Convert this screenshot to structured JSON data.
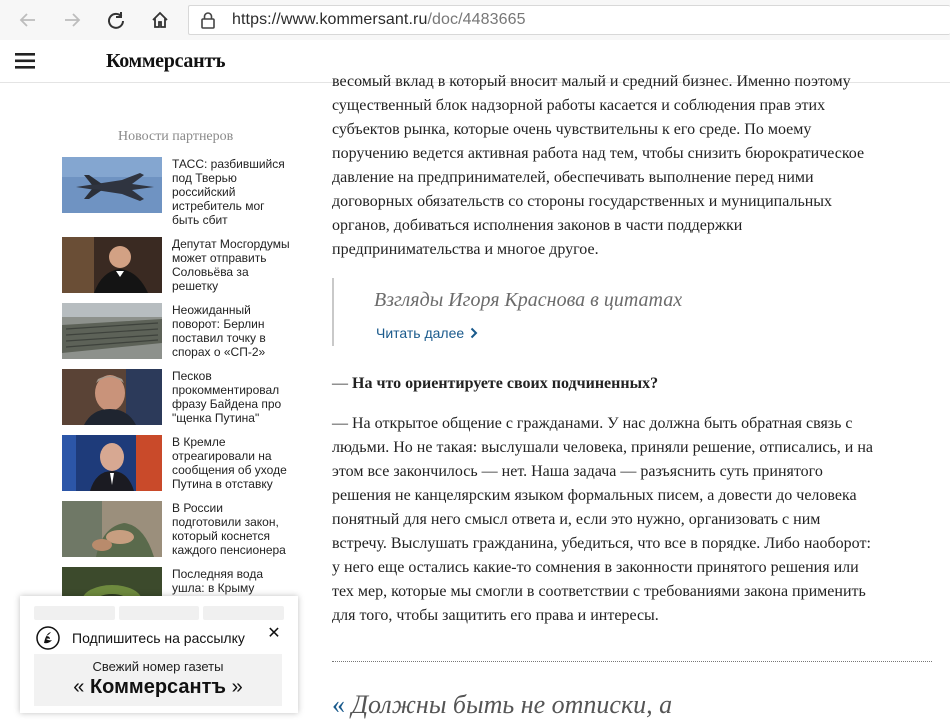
{
  "browser": {
    "url_host": "https://www.kommersant.ru",
    "url_path": "/doc/4483665",
    "icons": [
      "back-arrow-icon",
      "forward-arrow-icon",
      "reload-icon",
      "home-icon",
      "lock-icon"
    ]
  },
  "site": {
    "logo": "Коммерсантъ",
    "menu_icon": "hamburger-icon"
  },
  "sidebar": {
    "title": "Новости партнеров",
    "news": [
      {
        "lines": [
          "ТАСС: разбившийся",
          "под Тверью",
          "российский",
          "истребитель мог",
          "быть сбит"
        ],
        "thumb": "fighter-jet-image"
      },
      {
        "lines": [
          "Депутат Мосгордумы",
          "может отправить",
          "Соловьёва за",
          "решетку"
        ],
        "thumb": "man-in-tuxedo-image"
      },
      {
        "lines": [
          "Неожиданный",
          "поворот: Берлин",
          "поставил точку в",
          "спорах о «СП-2»"
        ],
        "thumb": "pipeline-image"
      },
      {
        "lines": [
          "Песков",
          "прокомментировал",
          "фразу Байдена про",
          "\"щенка Путина\""
        ],
        "thumb": "man-portrait-image"
      },
      {
        "lines": [
          "В Кремле",
          "отреагировали на",
          "сообщения об уходе",
          "Путина в отставку"
        ],
        "thumb": "president-portrait-image"
      },
      {
        "lines": [
          "В России",
          "подготовили закон,",
          "который коснется",
          "каждого пенсионера"
        ],
        "thumb": "elderly-hands-image"
      },
      {
        "lines": [
          "Последняя вода",
          "ушла: в Крыму"
        ],
        "thumb": "cave-water-image"
      }
    ]
  },
  "article": {
    "p1_lines": [
      "весомый вклад в который вносит малый и средний бизнес. Именно поэтому",
      "существенный блок надзорной работы касается и соблюдения прав этих",
      "субъектов рынка, которые очень чувствительны к его среде. По моему",
      "поручению ведется активная работа над тем, чтобы снизить бюрократическое",
      "давление на предпринимателей, обеспечивать выполнение перед ними",
      "договорных обязательств со стороны государственных и муниципальных",
      "органов, добиваться исполнения законов в части поддержки",
      "предпринимательства и многое другое."
    ],
    "quote_box": {
      "title": "Взгляды Игоря Краснова в цитатах",
      "link": "Читать далее"
    },
    "question_dash": "— ",
    "question": "На что ориентируете своих подчиненных?",
    "p2_lines": [
      "— На открытое общение с гражданами. У нас должна быть обратная связь с",
      "людьми. Но не такая: выслушали человека, приняли решение, отписались, и на",
      "этом все закончилось — нет. Наша задача — разъяснить суть принятого",
      "решения не канцелярским языком формальных писем, а довести до человека",
      "понятный для него смысл ответа и, если это нужно, организовать с ним",
      "встречу. Выслушать гражданина, убедиться, что все в порядке. Либо наоборот:",
      "у него еще остались какие-то сомнения в законности принятого решения или",
      "тех мер, которые мы смогли в соответствии с требованиями закона применить",
      "для того, чтобы защитить его права и интересы."
    ],
    "bottom_quote_mark": "«",
    "bottom_quote": "Должны быть не отписки, а"
  },
  "popup": {
    "subscribe_text": "Подпишитесь на рассылку",
    "close": "✕",
    "issue_label": "Свежий номер газеты",
    "issue_open": "«",
    "issue_brand": "Коммерсантъ",
    "issue_close": "»"
  },
  "colors": {
    "link": "#1a5a8c",
    "text": "#222222",
    "muted": "#8a8a8a"
  }
}
